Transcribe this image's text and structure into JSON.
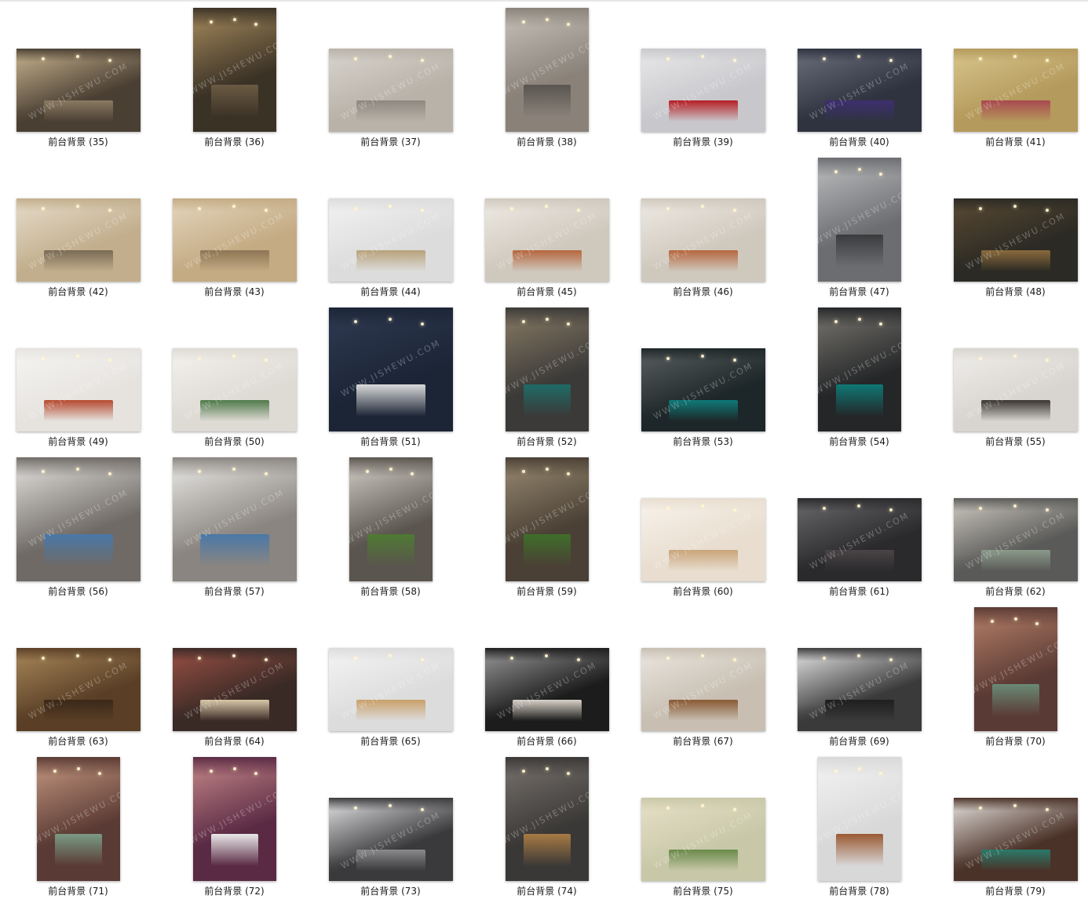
{
  "items": [
    {
      "label": "前台背景 (35)",
      "colors": [
        "#4a3f33",
        "#c9b48f",
        "#8a7a62"
      ],
      "shape": "landscape"
    },
    {
      "label": "前台背景 (36)",
      "colors": [
        "#3b3226",
        "#a88c5d",
        "#6b5a43"
      ],
      "shape": "portrait"
    },
    {
      "label": "前台背景 (37)",
      "colors": [
        "#b8b2a8",
        "#d8d4ce",
        "#8f8880"
      ],
      "shape": "landscape"
    },
    {
      "label": "前台背景 (38)",
      "colors": [
        "#8a8279",
        "#c7c2bb",
        "#5a5550"
      ],
      "shape": "portrait"
    },
    {
      "label": "前台背景 (39)",
      "colors": [
        "#c8c8cc",
        "#e8e8ea",
        "#b51f24"
      ],
      "shape": "landscape"
    },
    {
      "label": "前台背景 (40)",
      "colors": [
        "#2f3340",
        "#6c6f7c",
        "#3d2f6f"
      ],
      "shape": "landscape"
    },
    {
      "label": "前台背景 (41)",
      "colors": [
        "#b49a5c",
        "#d8c58c",
        "#a9484f"
      ],
      "shape": "landscape"
    },
    {
      "label": "前台背景 (42)",
      "colors": [
        "#c2ae8c",
        "#e6dccb",
        "#7a6b55"
      ],
      "shape": "landscape"
    },
    {
      "label": "前台背景 (43)",
      "colors": [
        "#c4ab84",
        "#e4d6bd",
        "#8e7655"
      ],
      "shape": "landscape"
    },
    {
      "label": "前台背景 (44)",
      "colors": [
        "#dcdcdc",
        "#f2f2f2",
        "#b8a27a"
      ],
      "shape": "landscape"
    },
    {
      "label": "前台背景 (45)",
      "colors": [
        "#cfc8bd",
        "#eeeae4",
        "#b6663d"
      ],
      "shape": "landscape"
    },
    {
      "label": "前台背景 (46)",
      "colors": [
        "#cfc8bd",
        "#eeeae4",
        "#b6663d"
      ],
      "shape": "landscape"
    },
    {
      "label": "前台背景 (47)",
      "colors": [
        "#6c6d70",
        "#bfc0c2",
        "#3a3b3d"
      ],
      "shape": "portrait"
    },
    {
      "label": "前台背景 (48)",
      "colors": [
        "#2b2a24",
        "#5a4a33",
        "#8a6a3c"
      ],
      "shape": "landscape"
    },
    {
      "label": "前台背景 (49)",
      "colors": [
        "#e6e3df",
        "#f6f5f3",
        "#b5492f"
      ],
      "shape": "landscape"
    },
    {
      "label": "前台背景 (50)",
      "colors": [
        "#dedad4",
        "#f4f2ef",
        "#4f7a4a"
      ],
      "shape": "landscape"
    },
    {
      "label": "前台背景 (51)",
      "colors": [
        "#1c2536",
        "#2f3a52",
        "#d9d9d9"
      ],
      "shape": "square"
    },
    {
      "label": "前台背景 (52)",
      "colors": [
        "#3b3a38",
        "#8a7c66",
        "#1f6b66"
      ],
      "shape": "portrait"
    },
    {
      "label": "前台背景 (53)",
      "colors": [
        "#1d2628",
        "#5a6060",
        "#0f7a78"
      ],
      "shape": "landscape"
    },
    {
      "label": "前台背景 (54)",
      "colors": [
        "#242628",
        "#7a7770",
        "#0e7875"
      ],
      "shape": "portrait"
    },
    {
      "label": "前台背景 (55)",
      "colors": [
        "#d8d5d0",
        "#f0eeeb",
        "#3a3532"
      ],
      "shape": "landscape"
    },
    {
      "label": "前台背景 (56)",
      "colors": [
        "#6f6a66",
        "#e6e4e1",
        "#4a78a8"
      ],
      "shape": "square"
    },
    {
      "label": "前台背景 (57)",
      "colors": [
        "#8a8580",
        "#ecebe8",
        "#4a78a8"
      ],
      "shape": "square"
    },
    {
      "label": "前台背景 (58)",
      "colors": [
        "#5a554e",
        "#d6d2cc",
        "#4f7a33"
      ],
      "shape": "portrait"
    },
    {
      "label": "前台背景 (59)",
      "colors": [
        "#4a4035",
        "#9a8b72",
        "#3f6f2a"
      ],
      "shape": "portrait"
    },
    {
      "label": "前台背景 (60)",
      "colors": [
        "#e8ddcf",
        "#f8f3ec",
        "#c9a57a"
      ],
      "shape": "landscape"
    },
    {
      "label": "前台背景 (61)",
      "colors": [
        "#2a2a2c",
        "#6a6a6c",
        "#4a4446"
      ],
      "shape": "landscape"
    },
    {
      "label": "前台背景 (62)",
      "colors": [
        "#5a5a58",
        "#cfcac2",
        "#8a9a8a"
      ],
      "shape": "landscape"
    },
    {
      "label": "前台背景 (63)",
      "colors": [
        "#5a3f26",
        "#a8885a",
        "#3a2818"
      ],
      "shape": "landscape"
    },
    {
      "label": "前台背景 (64)",
      "colors": [
        "#3a2a26",
        "#9a5044",
        "#d8c8a8"
      ],
      "shape": "landscape"
    },
    {
      "label": "前台背景 (65)",
      "colors": [
        "#dcdcdc",
        "#f4f4f4",
        "#c9a06a"
      ],
      "shape": "landscape"
    },
    {
      "label": "前台背景 (66)",
      "colors": [
        "#1c1c1c",
        "#9a9a9a",
        "#d9d2c8"
      ],
      "shape": "landscape"
    },
    {
      "label": "前台背景 (67)",
      "colors": [
        "#c8bfb2",
        "#eae6e0",
        "#8a5a34"
      ],
      "shape": "landscape"
    },
    {
      "label": "前台背景 (69)",
      "colors": [
        "#3a3a3a",
        "#e8e8e8",
        "#1e1e1e"
      ],
      "shape": "landscape"
    },
    {
      "label": "前台背景 (70)",
      "colors": [
        "#5a3a34",
        "#b8826a",
        "#6a8a76"
      ],
      "shape": "portrait"
    },
    {
      "label": "前台背景 (71)",
      "colors": [
        "#5a3a34",
        "#c89a82",
        "#7a9a86"
      ],
      "shape": "portrait"
    },
    {
      "label": "前台背景 (72)",
      "colors": [
        "#5a2a44",
        "#c88a8a",
        "#e8e8e8"
      ],
      "shape": "portrait"
    },
    {
      "label": "前台背景 (73)",
      "colors": [
        "#3a3a3c",
        "#e6e6e8",
        "#8a8a8c"
      ],
      "shape": "landscape"
    },
    {
      "label": "前台背景 (74)",
      "colors": [
        "#3a3836",
        "#7a7470",
        "#a87a44"
      ],
      "shape": "portrait"
    },
    {
      "label": "前台背景 (75)",
      "colors": [
        "#c8c8a8",
        "#e8e0c8",
        "#6a8a4a"
      ],
      "shape": "landscape"
    },
    {
      "label": "前台背景 (78)",
      "colors": [
        "#d8d8d8",
        "#f4f4f4",
        "#9a5a34"
      ],
      "shape": "portrait"
    },
    {
      "label": "前台背景 (79)",
      "colors": [
        "#4a3228",
        "#e8e4e0",
        "#2a7a6a"
      ],
      "shape": "landscape"
    }
  ]
}
